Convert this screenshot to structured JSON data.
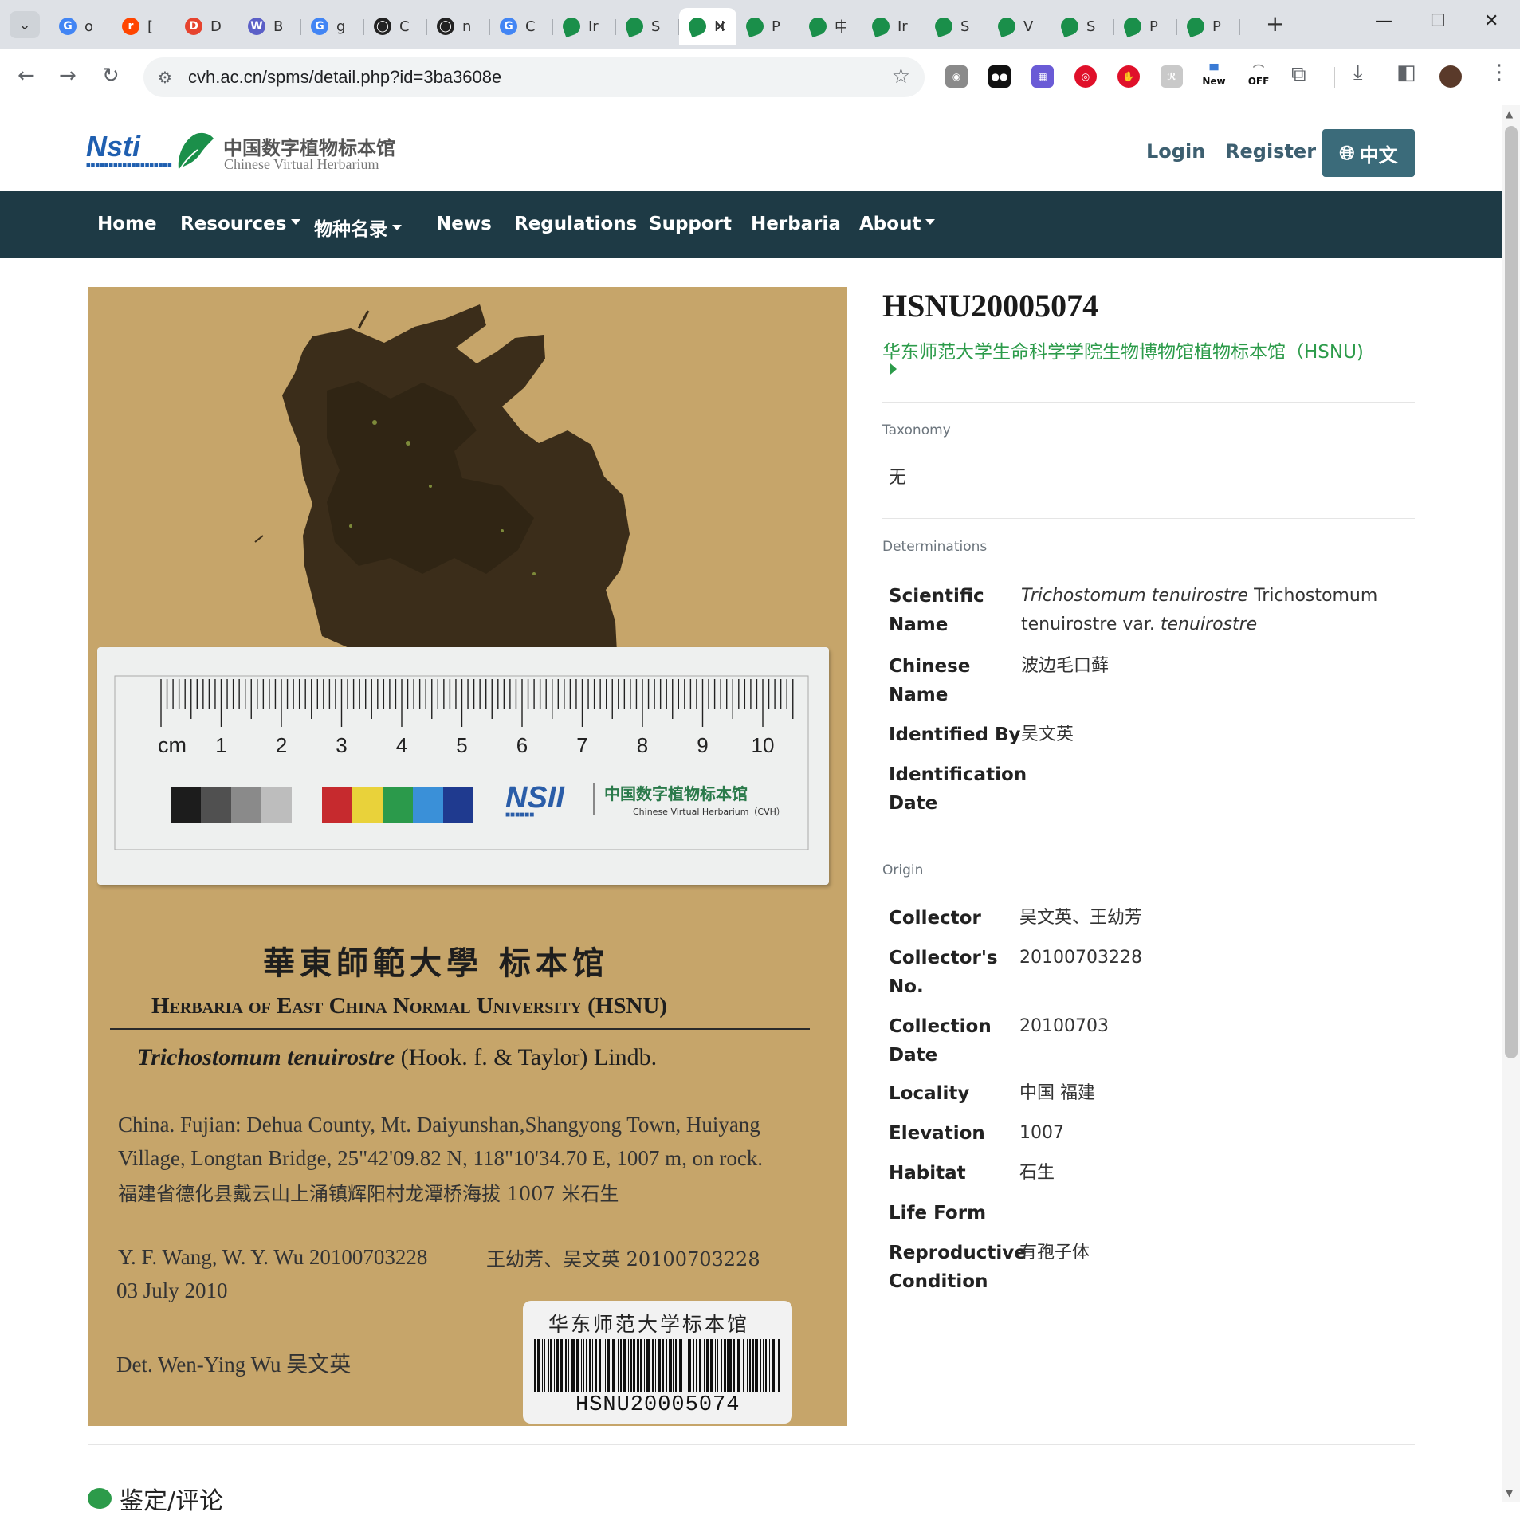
{
  "browser": {
    "tabs": [
      {
        "letter": "G",
        "title": "o",
        "color": "#4285f4"
      },
      {
        "letter": "r",
        "title": "[",
        "color": "#ff4500"
      },
      {
        "letter": "D",
        "title": "D",
        "color": "#e6432e"
      },
      {
        "letter": "W",
        "title": "B",
        "color": "#5b5fc7"
      },
      {
        "letter": "G",
        "title": "g",
        "color": "#4285f4"
      },
      {
        "letter": "◯",
        "title": "C",
        "color": "#222222"
      },
      {
        "letter": "◯",
        "title": "n",
        "color": "#222222"
      },
      {
        "letter": "G",
        "title": "C",
        "color": "#4285f4"
      },
      {
        "letter": "",
        "title": "Ir",
        "color": "#1a8f4a"
      },
      {
        "letter": "",
        "title": "S",
        "color": "#1a8f4a"
      },
      {
        "letter": "",
        "title": "H",
        "color": "#1a8f4a",
        "active": true
      },
      {
        "letter": "",
        "title": "P",
        "color": "#1a8f4a"
      },
      {
        "letter": "",
        "title": "中",
        "color": "#1a8f4a"
      },
      {
        "letter": "",
        "title": "Ir",
        "color": "#1a8f4a"
      },
      {
        "letter": "",
        "title": "S",
        "color": "#1a8f4a"
      },
      {
        "letter": "",
        "title": "V",
        "color": "#1a8f4a"
      },
      {
        "letter": "",
        "title": "S",
        "color": "#1a8f4a"
      },
      {
        "letter": "",
        "title": "P",
        "color": "#1a8f4a"
      },
      {
        "letter": "",
        "title": "P",
        "color": "#1a8f4a"
      }
    ],
    "url": "cvh.ac.cn/spms/detail.php?id=3ba3608e",
    "ext_new_label": "New",
    "ext_off_label": "OFF"
  },
  "header": {
    "nsti_logo": "Nsti",
    "brand_cn": "中国数字植物标本馆",
    "brand_en": "Chinese Virtual Herbarium",
    "login": "Login",
    "register": "Register",
    "language": "中文"
  },
  "nav": {
    "items": [
      {
        "label": "Home",
        "dropdown": false
      },
      {
        "label": "Resources",
        "dropdown": true
      },
      {
        "label": "物种名录",
        "dropdown": true
      },
      {
        "label": "News",
        "dropdown": false
      },
      {
        "label": "Regulations",
        "dropdown": false
      },
      {
        "label": "Support",
        "dropdown": false
      },
      {
        "label": "Herbaria",
        "dropdown": false
      },
      {
        "label": "About",
        "dropdown": true
      }
    ]
  },
  "specimen_image": {
    "ruler_unit": "cm",
    "ruler_numbers": [
      "1",
      "2",
      "3",
      "4",
      "5",
      "6",
      "7",
      "8",
      "9",
      "10"
    ],
    "card_logo": "NSII",
    "card_cn": "中国数字植物标本馆",
    "card_en": "Chinese Virtual Herbarium（CVH）",
    "label_cn_title": "華東師範大學 标本馆",
    "label_en_title": "Herbaria of East China Normal University (HSNU)",
    "label_sci_name": "Trichostomum tenuirostre",
    "label_sci_author": "(Hook. f. & Taylor) Lindb.",
    "label_locality_1": "China. Fujian: Dehua County, Mt. Daiyunshan,Shangyong Town, Huiyang",
    "label_locality_2": "Village, Longtan Bridge, 25\"42'09.82 N, 118\"10'34.70 E, 1007 m, on rock.",
    "label_locality_cn": "福建省德化县戴云山上涌镇辉阳村龙潭桥海拔 1007 米石生",
    "label_collectors_en": "Y. F. Wang, W. Y. Wu 20100703228",
    "label_collectors_cn": "王幼芳、吴文英 20100703228",
    "label_date": "03 July 2010",
    "label_det": "Det. Wen-Ying Wu  吴文英",
    "barcode_title": "华东师范大学标本馆",
    "barcode_number": "HSNU20005074",
    "swatch_colors": [
      "#1c1c1c",
      "#505050",
      "#8a8a8a",
      "#bdbdbd",
      "#c62a2e",
      "#e9d23a",
      "#2b9a4b",
      "#3a90d8",
      "#1f3a8f"
    ]
  },
  "detail": {
    "catalog_number": "HSNU20005074",
    "institution": "华东师范大学生命科学学院生物博物馆植物标本馆（HSNU)",
    "taxonomy_title": "Taxonomy",
    "taxonomy_value": "无",
    "determinations_title": "Determinations",
    "scientific_name_label": "Scientific Name",
    "scientific_name_italic": "Trichostomum tenuirostre",
    "scientific_name_rest": " Trichostomum tenuirostre var. ",
    "scientific_name_var": "tenuirostre",
    "chinese_name_label": "Chinese Name",
    "chinese_name": "波边毛口藓",
    "identified_by_label": "Identified By",
    "identified_by": "吴文英",
    "identification_date_label": "Identification Date",
    "identification_date": "",
    "origin_title": "Origin",
    "collector_label": "Collector",
    "collector": "吴文英、王幼芳",
    "collector_no_label": "Collector's No.",
    "collector_no": "20100703228",
    "collection_date_label": "Collection Date",
    "collection_date": "20100703",
    "locality_label": "Locality",
    "locality": "中国 福建",
    "elevation_label": "Elevation",
    "elevation": "1007",
    "habitat_label": "Habitat",
    "habitat": "石生",
    "life_form_label": "Life Form",
    "life_form": "",
    "reproductive_label": "Reproductive Condition",
    "reproductive": "有孢子体"
  },
  "comments": {
    "title": "鉴定/评论"
  }
}
